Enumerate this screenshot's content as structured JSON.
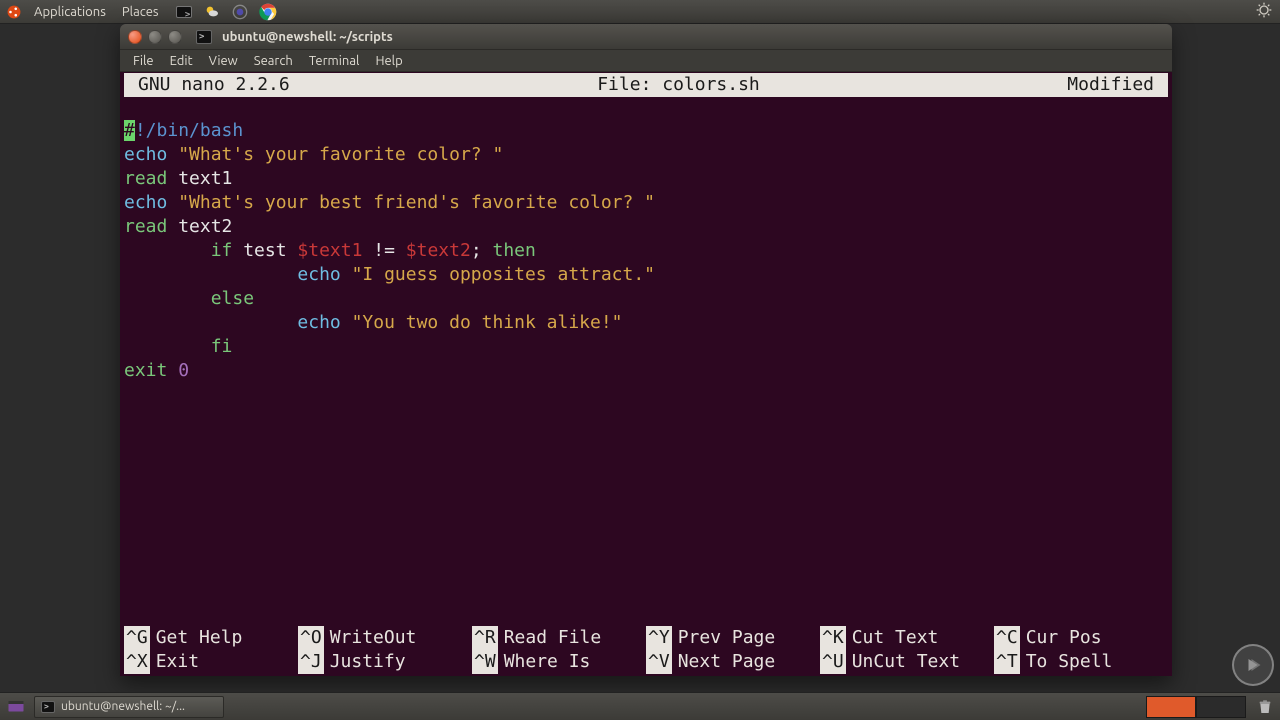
{
  "top_panel": {
    "applications": "Applications",
    "places": "Places",
    "tray_icons": [
      "terminal-icon",
      "weather-icon",
      "color-icon",
      "chrome-icon"
    ]
  },
  "window": {
    "title": "ubuntu@newshell: ~/scripts",
    "menu": [
      "File",
      "Edit",
      "View",
      "Search",
      "Terminal",
      "Help"
    ]
  },
  "nano": {
    "app": "GNU nano 2.2.6",
    "file_label": "File: colors.sh",
    "status": "Modified",
    "code": {
      "l1a": "#",
      "l1b": "!/bin/bash",
      "l2a": "echo ",
      "l2b": "\"What's your favorite color? \"",
      "l3a": "read ",
      "l3b": "text1",
      "l4a": "echo ",
      "l4b": "\"What's your best friend's favorite color? \"",
      "l5a": "read ",
      "l5b": "text2",
      "l6a": "        ",
      "l6b": "if ",
      "l6c": "test ",
      "l6d": "$text1 ",
      "l6e": "!= ",
      "l6f": "$text2",
      "l6g": "; ",
      "l6h": "then",
      "l7a": "                ",
      "l7b": "echo ",
      "l7c": "\"I guess opposites attract.\"",
      "l8a": "        ",
      "l8b": "else",
      "l9a": "                ",
      "l9b": "echo ",
      "l9c": "\"You two do think alike!\"",
      "l10a": "        ",
      "l10b": "fi",
      "l11a": "exit ",
      "l11b": "0"
    },
    "shortcuts": [
      {
        "key": "^G",
        "label": "Get Help"
      },
      {
        "key": "^O",
        "label": "WriteOut"
      },
      {
        "key": "^R",
        "label": "Read File"
      },
      {
        "key": "^Y",
        "label": "Prev Page"
      },
      {
        "key": "^K",
        "label": "Cut Text"
      },
      {
        "key": "^C",
        "label": "Cur Pos"
      },
      {
        "key": "^X",
        "label": "Exit"
      },
      {
        "key": "^J",
        "label": "Justify"
      },
      {
        "key": "^W",
        "label": "Where Is"
      },
      {
        "key": "^V",
        "label": "Next Page"
      },
      {
        "key": "^U",
        "label": "UnCut Text"
      },
      {
        "key": "^T",
        "label": "To Spell"
      }
    ]
  },
  "taskbar": {
    "task_label": "ubuntu@newshell: ~/..."
  }
}
